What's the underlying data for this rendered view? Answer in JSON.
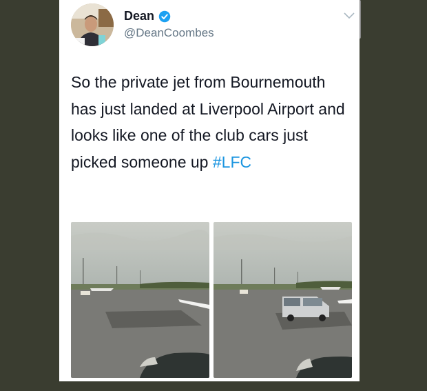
{
  "tweet": {
    "author_name": "Dean",
    "author_handle": "@DeanCoombes",
    "text_before": "So the private jet from Bournemouth has just landed at Liverpool Airport and looks like one of the club cars just picked someone up ",
    "hashtag": "#LFC"
  },
  "icons": {
    "verified": "verified-badge-icon",
    "menu": "chevron-down-icon"
  },
  "colors": {
    "hashtag": "#1b95e0",
    "verified": "#1da1f2",
    "handle": "#657786",
    "background": "#3a3d30"
  }
}
